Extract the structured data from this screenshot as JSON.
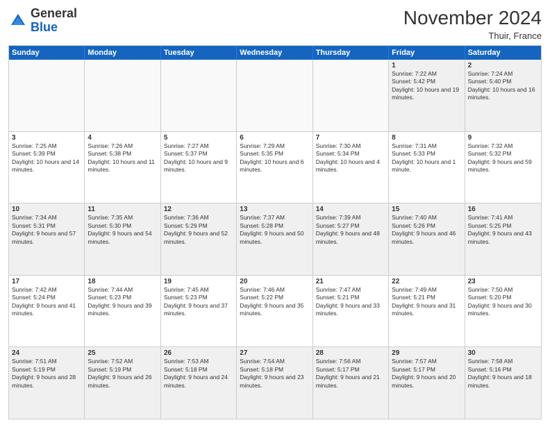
{
  "logo": {
    "general": "General",
    "blue": "Blue"
  },
  "header": {
    "month": "November 2024",
    "location": "Thuir, France"
  },
  "days": [
    "Sunday",
    "Monday",
    "Tuesday",
    "Wednesday",
    "Thursday",
    "Friday",
    "Saturday"
  ],
  "rows": [
    [
      {
        "day": "",
        "info": ""
      },
      {
        "day": "",
        "info": ""
      },
      {
        "day": "",
        "info": ""
      },
      {
        "day": "",
        "info": ""
      },
      {
        "day": "",
        "info": ""
      },
      {
        "day": "1",
        "info": "Sunrise: 7:22 AM\nSunset: 5:42 PM\nDaylight: 10 hours and 19 minutes."
      },
      {
        "day": "2",
        "info": "Sunrise: 7:24 AM\nSunset: 5:40 PM\nDaylight: 10 hours and 16 minutes."
      }
    ],
    [
      {
        "day": "3",
        "info": "Sunrise: 7:25 AM\nSunset: 5:39 PM\nDaylight: 10 hours and 14 minutes."
      },
      {
        "day": "4",
        "info": "Sunrise: 7:26 AM\nSunset: 5:38 PM\nDaylight: 10 hours and 11 minutes."
      },
      {
        "day": "5",
        "info": "Sunrise: 7:27 AM\nSunset: 5:37 PM\nDaylight: 10 hours and 9 minutes."
      },
      {
        "day": "6",
        "info": "Sunrise: 7:29 AM\nSunset: 5:35 PM\nDaylight: 10 hours and 6 minutes."
      },
      {
        "day": "7",
        "info": "Sunrise: 7:30 AM\nSunset: 5:34 PM\nDaylight: 10 hours and 4 minutes."
      },
      {
        "day": "8",
        "info": "Sunrise: 7:31 AM\nSunset: 5:33 PM\nDaylight: 10 hours and 1 minute."
      },
      {
        "day": "9",
        "info": "Sunrise: 7:32 AM\nSunset: 5:32 PM\nDaylight: 9 hours and 59 minutes."
      }
    ],
    [
      {
        "day": "10",
        "info": "Sunrise: 7:34 AM\nSunset: 5:31 PM\nDaylight: 9 hours and 57 minutes."
      },
      {
        "day": "11",
        "info": "Sunrise: 7:35 AM\nSunset: 5:30 PM\nDaylight: 9 hours and 54 minutes."
      },
      {
        "day": "12",
        "info": "Sunrise: 7:36 AM\nSunset: 5:29 PM\nDaylight: 9 hours and 52 minutes."
      },
      {
        "day": "13",
        "info": "Sunrise: 7:37 AM\nSunset: 5:28 PM\nDaylight: 9 hours and 50 minutes."
      },
      {
        "day": "14",
        "info": "Sunrise: 7:39 AM\nSunset: 5:27 PM\nDaylight: 9 hours and 48 minutes."
      },
      {
        "day": "15",
        "info": "Sunrise: 7:40 AM\nSunset: 5:26 PM\nDaylight: 9 hours and 46 minutes."
      },
      {
        "day": "16",
        "info": "Sunrise: 7:41 AM\nSunset: 5:25 PM\nDaylight: 9 hours and 43 minutes."
      }
    ],
    [
      {
        "day": "17",
        "info": "Sunrise: 7:42 AM\nSunset: 5:24 PM\nDaylight: 9 hours and 41 minutes."
      },
      {
        "day": "18",
        "info": "Sunrise: 7:44 AM\nSunset: 5:23 PM\nDaylight: 9 hours and 39 minutes."
      },
      {
        "day": "19",
        "info": "Sunrise: 7:45 AM\nSunset: 5:23 PM\nDaylight: 9 hours and 37 minutes."
      },
      {
        "day": "20",
        "info": "Sunrise: 7:46 AM\nSunset: 5:22 PM\nDaylight: 9 hours and 35 minutes."
      },
      {
        "day": "21",
        "info": "Sunrise: 7:47 AM\nSunset: 5:21 PM\nDaylight: 9 hours and 33 minutes."
      },
      {
        "day": "22",
        "info": "Sunrise: 7:49 AM\nSunset: 5:21 PM\nDaylight: 9 hours and 31 minutes."
      },
      {
        "day": "23",
        "info": "Sunrise: 7:50 AM\nSunset: 5:20 PM\nDaylight: 9 hours and 30 minutes."
      }
    ],
    [
      {
        "day": "24",
        "info": "Sunrise: 7:51 AM\nSunset: 5:19 PM\nDaylight: 9 hours and 28 minutes."
      },
      {
        "day": "25",
        "info": "Sunrise: 7:52 AM\nSunset: 5:19 PM\nDaylight: 9 hours and 26 minutes."
      },
      {
        "day": "26",
        "info": "Sunrise: 7:53 AM\nSunset: 5:18 PM\nDaylight: 9 hours and 24 minutes."
      },
      {
        "day": "27",
        "info": "Sunrise: 7:54 AM\nSunset: 5:18 PM\nDaylight: 9 hours and 23 minutes."
      },
      {
        "day": "28",
        "info": "Sunrise: 7:56 AM\nSunset: 5:17 PM\nDaylight: 9 hours and 21 minutes."
      },
      {
        "day": "29",
        "info": "Sunrise: 7:57 AM\nSunset: 5:17 PM\nDaylight: 9 hours and 20 minutes."
      },
      {
        "day": "30",
        "info": "Sunrise: 7:58 AM\nSunset: 5:16 PM\nDaylight: 9 hours and 18 minutes."
      }
    ]
  ]
}
